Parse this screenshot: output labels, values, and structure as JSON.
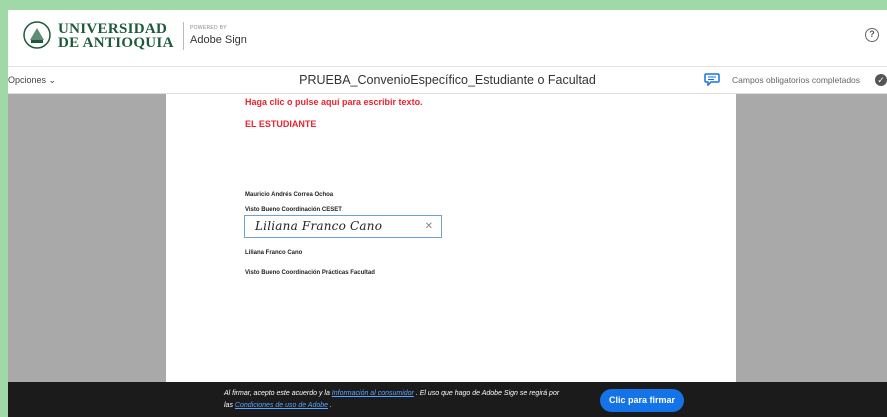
{
  "header": {
    "org_line1": "UNIVERSIDAD",
    "org_line2": "DE ANTIOQUIA",
    "powered_by": "POWERED BY",
    "product": "Adobe Sign",
    "help_icon": "help-circle-icon"
  },
  "toolbar": {
    "options_label": "Opciones",
    "doc_title": "PRUEBA_ConvenioEspecífico_Estudiante o Facultad",
    "status_text": "Campos obligatorios completados"
  },
  "document": {
    "placeholder_text": "Haga clic o pulse aquí para escribir texto.",
    "student_label": "EL ESTUDIANTE",
    "name1": "Mauricio Andrés Correa Ochoa",
    "role1": "Visto Bueno Coordinación CESET",
    "signature_value": "Liliana Franco Cano",
    "name2": "Liliana Franco Cano",
    "role2": "Visto Bueno Coordinación Prácticas Facultad"
  },
  "footer": {
    "text_a": "Al firmar, acepto este acuerdo y la ",
    "link_a": "Información al consumidor",
    "text_b": ". El uso que hago de Adobe Sign se regirá por las ",
    "link_b": "Condiciones de uso de Adobe",
    "text_c": ".",
    "sign_button": "Clic para firmar"
  },
  "colors": {
    "accent": "#1473e6",
    "required_text": "#e8242f",
    "brand": "#1d5a3a"
  }
}
